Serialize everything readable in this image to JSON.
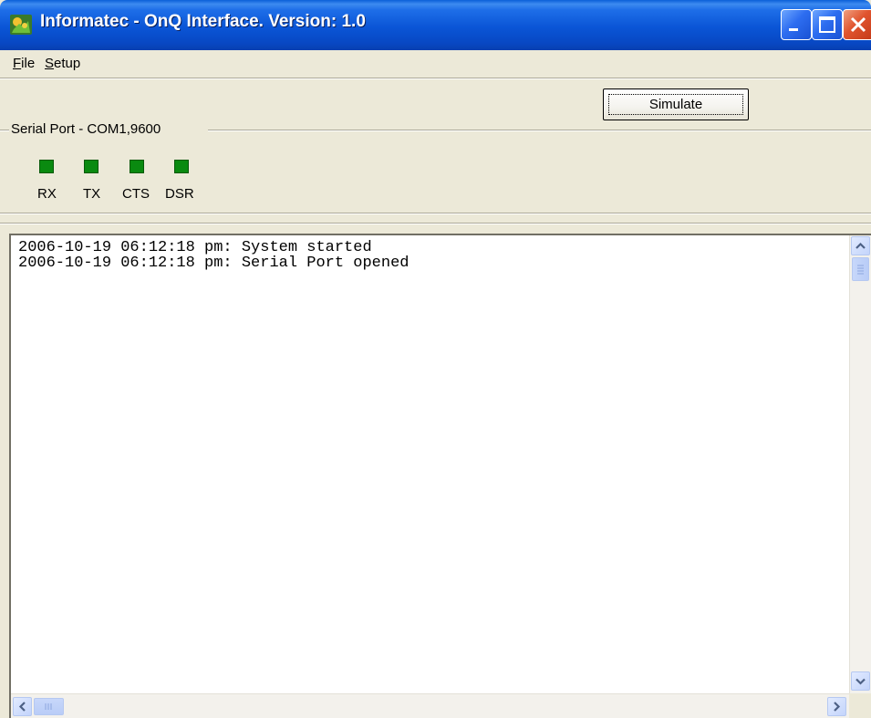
{
  "window": {
    "title": "Informatec - OnQ Interface. Version: 1.0",
    "icons": {
      "app": "app-logo-icon",
      "minimize": "minimize-icon",
      "maximize": "maximize-icon",
      "close": "close-icon"
    },
    "colors": {
      "titlebar": "#0a55d6",
      "face": "#ece9d8",
      "close": "#e0542e"
    }
  },
  "menu": {
    "file": {
      "mnemonic": "F",
      "rest": "ile"
    },
    "setup": {
      "mnemonic": "S",
      "rest": "etup"
    }
  },
  "toolbar": {
    "simulate_label": "Simulate"
  },
  "serial": {
    "group_title": "Serial Port  -  COM1,9600",
    "indicators": [
      {
        "label": "RX",
        "color": "#0a8a10"
      },
      {
        "label": "TX",
        "color": "#0a8a10"
      },
      {
        "label": "CTS",
        "color": "#0a8a10"
      },
      {
        "label": "DSR",
        "color": "#0a8a10"
      }
    ]
  },
  "log": {
    "lines": [
      "2006-10-19 06:12:18 pm: System started",
      "2006-10-19 06:12:18 pm: Serial Port opened"
    ]
  },
  "scrollbars": {
    "icons": {
      "up": "chevron-up-icon",
      "down": "chevron-down-icon",
      "left": "chevron-left-icon",
      "right": "chevron-right-icon"
    }
  }
}
